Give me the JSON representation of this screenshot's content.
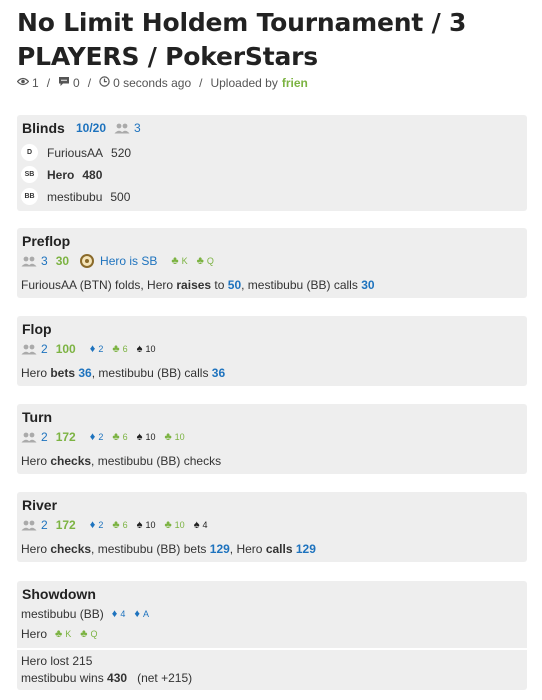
{
  "title": "No Limit Holdem Tournament / 3 PLAYERS / PokerStars",
  "meta": {
    "views": "1",
    "comments": "0",
    "time": "0 seconds ago",
    "uploaded_prefix": "Uploaded by",
    "uploader": "frien"
  },
  "blinds": {
    "title": "Blinds",
    "level": "10/20",
    "players": "3",
    "seats": [
      {
        "pos": "D",
        "name": "FuriousAA",
        "stack": "520",
        "hero": false
      },
      {
        "pos": "SB",
        "name": "Hero",
        "stack": "480",
        "hero": true
      },
      {
        "pos": "BB",
        "name": "mestibubu",
        "stack": "500",
        "hero": false
      }
    ]
  },
  "preflop": {
    "title": "Preflop",
    "players": "3",
    "pot": "30",
    "hero_pos": "Hero is SB",
    "cards": [
      {
        "suit": "club",
        "rank": "K"
      },
      {
        "suit": "club",
        "rank": "Q"
      }
    ],
    "action": {
      "a": "FuriousAA (BTN) folds, Hero ",
      "b": "raises",
      "c": " to ",
      "d": "50",
      "e": ", mestibubu (BB) calls ",
      "f": "30"
    }
  },
  "flop": {
    "title": "Flop",
    "players": "2",
    "pot": "100",
    "cards": [
      {
        "suit": "diamond",
        "rank": "2"
      },
      {
        "suit": "club",
        "rank": "6"
      },
      {
        "suit": "spade",
        "rank": "10"
      }
    ],
    "action": {
      "a": "Hero ",
      "b": "bets",
      "c": " ",
      "d": "36",
      "e": ", mestibubu (BB) calls ",
      "f": "36"
    }
  },
  "turn": {
    "title": "Turn",
    "players": "2",
    "pot": "172",
    "cards": [
      {
        "suit": "diamond",
        "rank": "2"
      },
      {
        "suit": "club",
        "rank": "6"
      },
      {
        "suit": "spade",
        "rank": "10"
      },
      {
        "suit": "club",
        "rank": "10"
      }
    ],
    "action": {
      "a": "Hero ",
      "b": "checks",
      "c": ", mestibubu (BB) checks"
    }
  },
  "river": {
    "title": "River",
    "players": "2",
    "pot": "172",
    "cards": [
      {
        "suit": "diamond",
        "rank": "2"
      },
      {
        "suit": "club",
        "rank": "6"
      },
      {
        "suit": "spade",
        "rank": "10"
      },
      {
        "suit": "club",
        "rank": "10"
      },
      {
        "suit": "spade",
        "rank": "4"
      }
    ],
    "action": {
      "a": "Hero ",
      "b": "checks",
      "c": ", mestibubu (BB) bets ",
      "d": "129",
      "e": ", Hero ",
      "f": "calls",
      "g": " ",
      "h": "129"
    }
  },
  "showdown": {
    "title": "Showdown",
    "hands": [
      {
        "name": "mestibubu (BB)",
        "cards": [
          {
            "suit": "diamond",
            "rank": "4"
          },
          {
            "suit": "diamond",
            "rank": "A"
          }
        ]
      },
      {
        "name": "Hero",
        "cards": [
          {
            "suit": "club",
            "rank": "K"
          },
          {
            "suit": "club",
            "rank": "Q"
          }
        ]
      }
    ],
    "result1": "Hero lost 215",
    "result2_a": "mestibubu wins ",
    "result2_b": "430",
    "result2_c": "(net +215)"
  }
}
